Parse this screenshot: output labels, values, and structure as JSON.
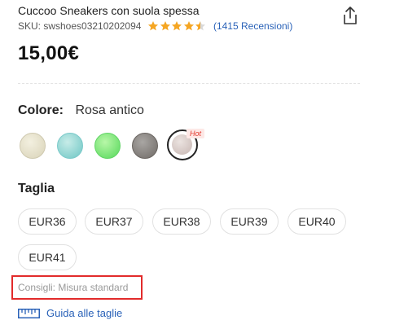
{
  "product": {
    "title": "Cuccoo Sneakers con suola spessa",
    "sku": "SKU: swshoes03210202094",
    "rating": 4.5,
    "reviews": "(1415 Recensioni)",
    "price": "15,00€"
  },
  "colors": {
    "label": "Colore:",
    "selected_value": "Rosa antico",
    "hot_badge": "Hot",
    "swatches": [
      {
        "name": "cream",
        "color": "#e6e1c8"
      },
      {
        "name": "aqua",
        "color": "#9bd9d6"
      },
      {
        "name": "green",
        "color": "#7de87a"
      },
      {
        "name": "grey",
        "color": "#8a8581"
      },
      {
        "name": "antique-pink",
        "color": "#d8cac6",
        "selected": true
      }
    ]
  },
  "sizes": {
    "label": "Taglia",
    "options": [
      "EUR36",
      "EUR37",
      "EUR38",
      "EUR39",
      "EUR40",
      "EUR41"
    ],
    "tip": "Consigli: Misura standard",
    "guide_label": "Guida alle taglie"
  },
  "theme": {
    "star_color": "#f5a623",
    "link_color": "#2a62b8",
    "highlight_border": "#e22b2b",
    "hot_color": "#e43a2f"
  }
}
